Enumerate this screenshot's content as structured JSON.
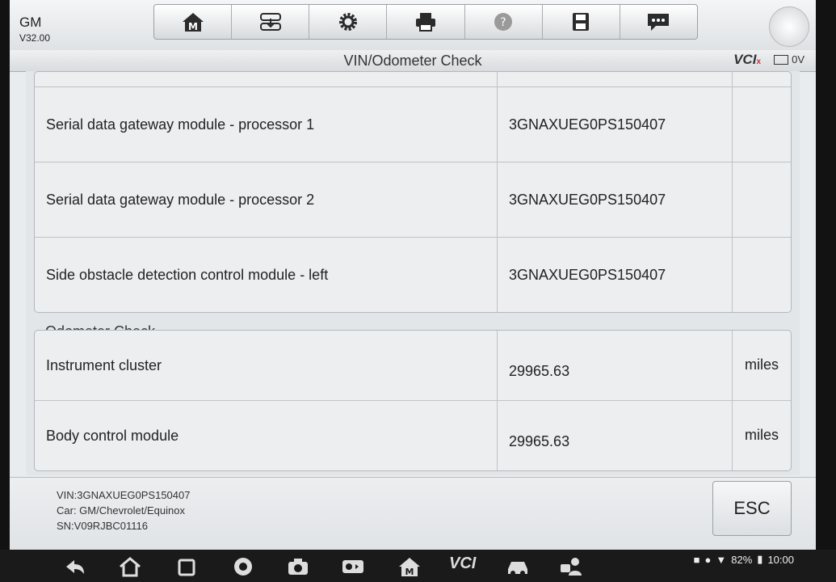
{
  "header": {
    "make": "GM",
    "version": "V32.00",
    "title": "VIN/Odometer Check",
    "vci_label": "VCI",
    "vci_status_mark": "x",
    "voltage": "0V"
  },
  "toolbar": {
    "icons": [
      "home-icon",
      "vehicle-swap-icon",
      "settings-gear-icon",
      "printer-icon",
      "help-icon",
      "save-icon",
      "message-icon"
    ],
    "home_letter": "M"
  },
  "vin_rows": [
    {
      "module": "Serial data gateway module - processor 1",
      "value": "3GNAXUEG0PS150407",
      "unit": ""
    },
    {
      "module": "Serial data gateway module - processor 2",
      "value": "3GNAXUEG0PS150407",
      "unit": ""
    },
    {
      "module": "Side obstacle detection control module - left",
      "value": "3GNAXUEG0PS150407",
      "unit": ""
    }
  ],
  "odometer": {
    "section_label": "Odometer Check",
    "rows": [
      {
        "module": "Instrument cluster",
        "value": "29965.63",
        "unit": "miles"
      },
      {
        "module": "Body control module",
        "value": "29965.63",
        "unit": "miles"
      }
    ]
  },
  "footer": {
    "vin": "VIN:3GNAXUEG0PS150407",
    "car": "Car: GM/Chevrolet/Equinox",
    "sn": "SN:V09RJBC01116",
    "esc_label": "ESC"
  },
  "system_bar": {
    "battery": "82%",
    "time": "10:00",
    "vci_label": "VCI"
  }
}
